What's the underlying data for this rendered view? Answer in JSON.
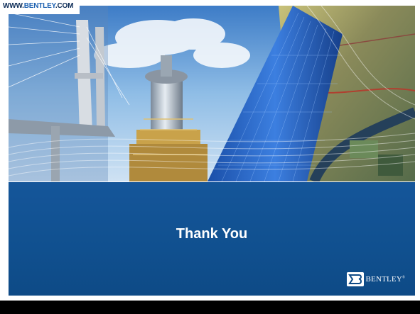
{
  "header": {
    "url_prefix": "WWW.",
    "url_brand": "BENTLEY",
    "url_suffix": ".COM"
  },
  "slide": {
    "title": "Thank You"
  },
  "logo": {
    "text": "BENTLEY",
    "trademark": "®"
  },
  "colors": {
    "banner": "#10508f",
    "sky": "#7fb3e0",
    "tower": "#2c5fb5"
  },
  "icons": [
    "bentley-logo-icon"
  ]
}
